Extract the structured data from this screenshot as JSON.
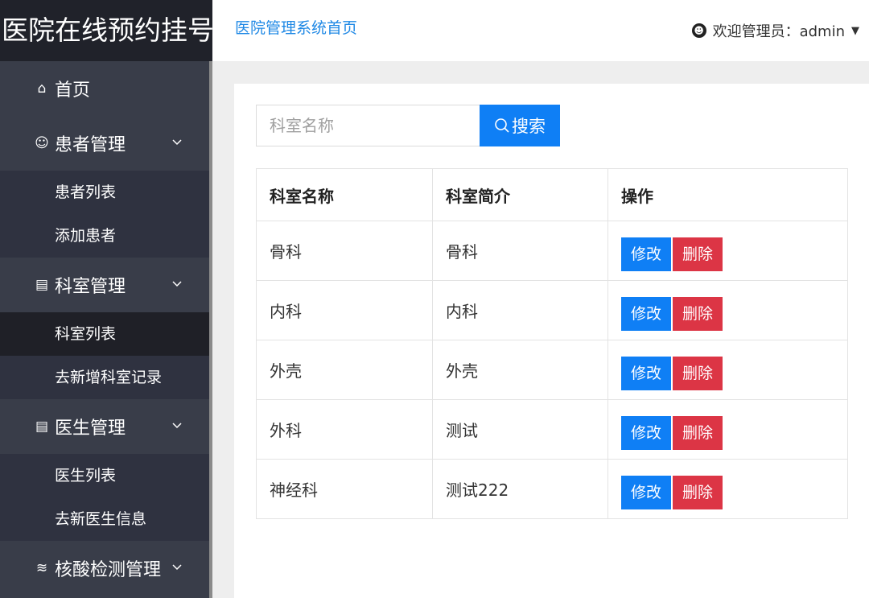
{
  "app": {
    "logo": "医院在线预约挂号"
  },
  "header": {
    "home_link": "医院管理系统首页",
    "user_label": "欢迎管理员：admin"
  },
  "sidebar": {
    "home": "首页",
    "groups": [
      {
        "label": "患者管理",
        "items": [
          "患者列表",
          "添加患者"
        ]
      },
      {
        "label": "科室管理",
        "items": [
          "科室列表",
          "去新增科室记录"
        ]
      },
      {
        "label": "医生管理",
        "items": [
          "医生列表",
          "去新医生信息"
        ]
      },
      {
        "label": "核酸检测管理",
        "items": []
      }
    ],
    "active_item": "科室列表"
  },
  "search": {
    "placeholder": "科室名称",
    "button_label": "搜索"
  },
  "table": {
    "columns": [
      "科室名称",
      "科室简介",
      "操作"
    ],
    "rows": [
      {
        "name": "骨科",
        "desc": "骨科",
        "edit": "修改",
        "delete": "删除"
      },
      {
        "name": "内科",
        "desc": "内科",
        "edit": "修改",
        "delete": "删除"
      },
      {
        "name": "外壳",
        "desc": "外壳",
        "edit": "修改",
        "delete": "删除"
      },
      {
        "name": "外科",
        "desc": "测试",
        "edit": "修改",
        "delete": "删除"
      },
      {
        "name": "神经科",
        "desc": "测试222",
        "edit": "修改",
        "delete": "删除"
      }
    ]
  },
  "colors": {
    "primary": "#0f7ff5",
    "danger": "#dc3545",
    "sidebar": "#393d49",
    "logo_bg": "#20222a"
  }
}
